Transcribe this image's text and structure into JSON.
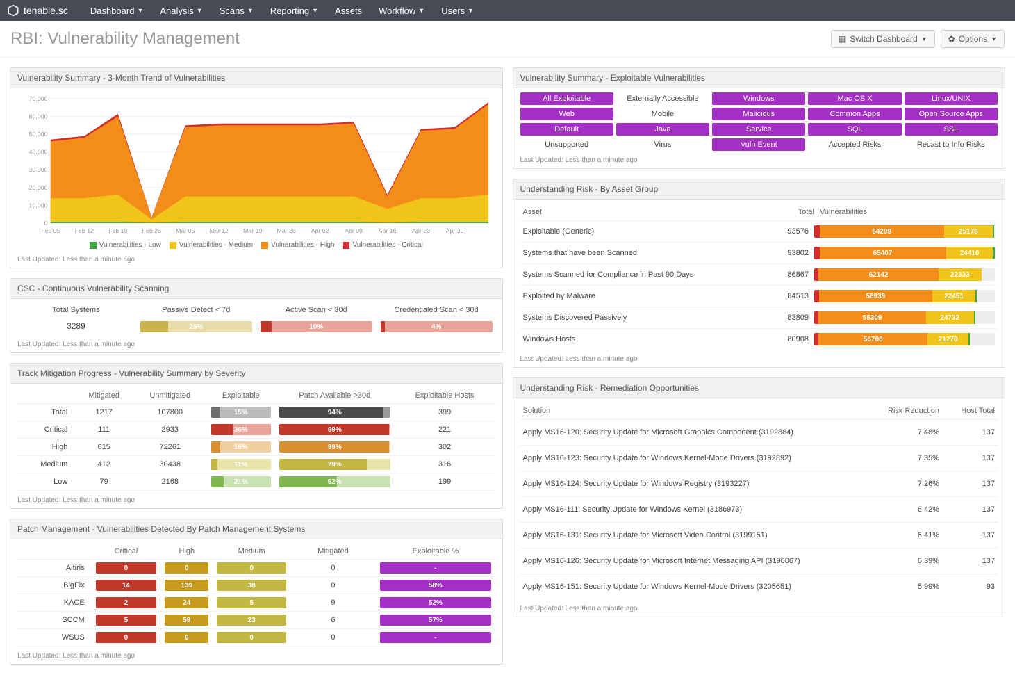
{
  "brand": "tenable.sc",
  "nav": [
    "Dashboard",
    "Analysis",
    "Scans",
    "Reporting",
    "Assets",
    "Workflow",
    "Users"
  ],
  "nav_nodrop": [
    "Assets"
  ],
  "page_title": "RBI: Vulnerability Management",
  "header_buttons": {
    "switch": "Switch Dashboard",
    "options": "Options"
  },
  "last_updated": "Last Updated: Less than a minute ago",
  "trend_panel": {
    "title": "Vulnerability Summary - 3-Month Trend of Vulnerabilities",
    "ymax": 70000,
    "yticks": [
      0,
      10000,
      20000,
      30000,
      40000,
      50000,
      60000,
      70000
    ],
    "xlabels": [
      "Feb 05",
      "Feb 12",
      "Feb 19",
      "Feb 26",
      "Mar 05",
      "Mar 12",
      "Mar 19",
      "Mar 26",
      "Apr 02",
      "Apr 09",
      "Apr 16",
      "Apr 23",
      "Apr 30"
    ],
    "legend": [
      {
        "label": "Vulnerabilities - Low",
        "color": "#3fa63f"
      },
      {
        "label": "Vulnerabilities - Medium",
        "color": "#f0c419"
      },
      {
        "label": "Vulnerabilities - High",
        "color": "#f28d1a"
      },
      {
        "label": "Vulnerabilities - Critical",
        "color": "#d32d2d"
      }
    ]
  },
  "chart_data": {
    "type": "area",
    "title": "Vulnerability Summary - 3-Month Trend of Vulnerabilities",
    "xlabel": "",
    "ylabel": "",
    "ylim": [
      0,
      70000
    ],
    "x": [
      "Feb 05",
      "Feb 12",
      "Feb 19",
      "Feb 26",
      "Mar 05",
      "Mar 12",
      "Mar 19",
      "Mar 26",
      "Apr 02",
      "Apr 09",
      "Apr 16",
      "Apr 23",
      "Apr 30",
      ""
    ],
    "series": [
      {
        "name": "Vulnerabilities - Low",
        "color": "#3fa63f",
        "values": [
          700,
          700,
          700,
          200,
          700,
          700,
          700,
          700,
          700,
          700,
          200,
          700,
          700,
          700
        ]
      },
      {
        "name": "Vulnerabilities - Medium",
        "color": "#f0c419",
        "values": [
          14000,
          14000,
          16000,
          2000,
          15000,
          15000,
          15000,
          15000,
          15000,
          15000,
          8000,
          14000,
          14000,
          16000
        ]
      },
      {
        "name": "Vulnerabilities - High",
        "color": "#f28d1a",
        "values": [
          46000,
          48000,
          60000,
          3000,
          54000,
          55000,
          55000,
          55000,
          55000,
          56000,
          15000,
          52000,
          53000,
          67000
        ]
      },
      {
        "name": "Vulnerabilities - Critical",
        "color": "#d32d2d",
        "values": [
          47000,
          49000,
          61500,
          3200,
          55000,
          56000,
          56000,
          56000,
          56000,
          57000,
          16000,
          53000,
          54000,
          68000
        ]
      }
    ]
  },
  "csc": {
    "title": "CSC - Continuous Vulnerability Scanning",
    "headers": [
      "Total Systems",
      "Passive Detect < 7d",
      "Active Scan < 30d",
      "Credentialed Scan < 30d"
    ],
    "total_systems": "3289",
    "bars": [
      {
        "pct": 25,
        "fill": "#cbb24b",
        "rest": "#e7dca7"
      },
      {
        "pct": 10,
        "fill": "#c0392b",
        "rest": "#e8a39b"
      },
      {
        "pct": 4,
        "fill": "#c0392b",
        "rest": "#e8a39b"
      }
    ]
  },
  "mitigation": {
    "title": "Track Mitigation Progress - Vulnerability Summary by Severity",
    "headers": [
      "",
      "Mitigated",
      "Unmitigated",
      "Exploitable",
      "Patch Available >30d",
      "Exploitable Hosts"
    ],
    "rows": [
      {
        "label": "Total",
        "mitigated": "1217",
        "unmitigated": "107800",
        "exp": {
          "pct": 15,
          "fill": "#6e6e6e",
          "rest": "#bcbcbc"
        },
        "patch": {
          "pct": 94,
          "fill": "#4a4a4a",
          "rest": "#9a9a9a"
        },
        "hosts": "399"
      },
      {
        "label": "Critical",
        "mitigated": "111",
        "unmitigated": "2933",
        "exp": {
          "pct": 36,
          "fill": "#c0392b",
          "rest": "#e8a39b"
        },
        "patch": {
          "pct": 99,
          "fill": "#c0392b",
          "rest": "#e8a39b"
        },
        "hosts": "221"
      },
      {
        "label": "High",
        "mitigated": "615",
        "unmitigated": "72261",
        "exp": {
          "pct": 16,
          "fill": "#d89033",
          "rest": "#f1cfa0"
        },
        "patch": {
          "pct": 99,
          "fill": "#d89033",
          "rest": "#f1cfa0"
        },
        "hosts": "302"
      },
      {
        "label": "Medium",
        "mitigated": "412",
        "unmitigated": "30438",
        "exp": {
          "pct": 11,
          "fill": "#c2b843",
          "rest": "#e8e3a9"
        },
        "patch": {
          "pct": 79,
          "fill": "#c2b843",
          "rest": "#e8e3a9"
        },
        "hosts": "316"
      },
      {
        "label": "Low",
        "mitigated": "79",
        "unmitigated": "2168",
        "exp": {
          "pct": 21,
          "fill": "#7fb84e",
          "rest": "#c9e2b1"
        },
        "patch": {
          "pct": 52,
          "fill": "#7fb84e",
          "rest": "#c9e2b1"
        },
        "hosts": "199"
      }
    ]
  },
  "patch": {
    "title": "Patch Management - Vulnerabilities Detected By Patch Management Systems",
    "headers": [
      "",
      "Critical",
      "High",
      "Medium",
      "Mitigated",
      "Exploitable %"
    ],
    "colors": {
      "crit": "#c0392b",
      "high": "#c69b1b",
      "med": "#c2b843",
      "exp": "#a42fc4"
    },
    "rows": [
      {
        "label": "Altiris",
        "crit": "0",
        "high": "0",
        "med": "0",
        "mit": "0",
        "exp": "-"
      },
      {
        "label": "BigFix",
        "crit": "14",
        "high": "139",
        "med": "38",
        "mit": "0",
        "exp": "58%"
      },
      {
        "label": "KACE",
        "crit": "2",
        "high": "24",
        "med": "5",
        "mit": "9",
        "exp": "52%"
      },
      {
        "label": "SCCM",
        "crit": "5",
        "high": "59",
        "med": "23",
        "mit": "6",
        "exp": "57%"
      },
      {
        "label": "WSUS",
        "crit": "0",
        "high": "0",
        "med": "0",
        "mit": "0",
        "exp": "-"
      }
    ]
  },
  "exploitable": {
    "title": "Vulnerability Summary - Exploitable Vulnerabilities",
    "cells": [
      {
        "t": "All Exploitable",
        "f": true
      },
      {
        "t": "Externally Accessible",
        "f": false
      },
      {
        "t": "Windows",
        "f": true
      },
      {
        "t": "Mac OS X",
        "f": true
      },
      {
        "t": "Linux/UNIX",
        "f": true
      },
      {
        "t": "Web",
        "f": true
      },
      {
        "t": "Mobile",
        "f": false
      },
      {
        "t": "Malicious",
        "f": true
      },
      {
        "t": "Common Apps",
        "f": true
      },
      {
        "t": "Open Source Apps",
        "f": true
      },
      {
        "t": "Default",
        "f": true
      },
      {
        "t": "Java",
        "f": true
      },
      {
        "t": "Service",
        "f": true
      },
      {
        "t": "SQL",
        "f": true
      },
      {
        "t": "SSL",
        "f": true
      },
      {
        "t": "Unsupported",
        "f": false
      },
      {
        "t": "Virus",
        "f": false
      },
      {
        "t": "Vuln Event",
        "f": true
      },
      {
        "t": "Accepted Risks",
        "f": false
      },
      {
        "t": "Recast to Info Risks",
        "f": false
      }
    ]
  },
  "asset_group": {
    "title": "Understanding Risk - By Asset Group",
    "headers": [
      "Asset",
      "Total",
      "Vulnerabilities"
    ],
    "max": 93802,
    "rows": [
      {
        "asset": "Exploitable (Generic)",
        "total": 93576,
        "crit": 2700,
        "high": 64299,
        "med": 25178,
        "low": 900
      },
      {
        "asset": "Systems that have been Scanned",
        "total": 93802,
        "crit": 2700,
        "high": 65407,
        "med": 24410,
        "low": 900
      },
      {
        "asset": "Systems Scanned for Compliance in Past 90 Days",
        "total": 86867,
        "crit": 2300,
        "high": 62142,
        "med": 22333,
        "low": 0
      },
      {
        "asset": "Exploited by Malware",
        "total": 84513,
        "crit": 2400,
        "high": 58939,
        "med": 22451,
        "low": 700
      },
      {
        "asset": "Systems Discovered Passively",
        "total": 83809,
        "crit": 2300,
        "high": 55309,
        "med": 24732,
        "low": 900
      },
      {
        "asset": "Windows Hosts",
        "total": 80908,
        "crit": 2200,
        "high": 56708,
        "med": 21270,
        "low": 700
      }
    ]
  },
  "remediation": {
    "title": "Understanding Risk - Remediation Opportunities",
    "headers": [
      "Solution",
      "Risk Reduction",
      "Host Total"
    ],
    "rows": [
      {
        "s": "Apply MS16-120: Security Update for Microsoft Graphics Component (3192884)",
        "r": "7.48%",
        "h": "137"
      },
      {
        "s": "Apply MS16-123: Security Update for Windows Kernel-Mode Drivers (3192892)",
        "r": "7.35%",
        "h": "137"
      },
      {
        "s": "Apply MS16-124: Security Update for Windows Registry (3193227)",
        "r": "7.26%",
        "h": "137"
      },
      {
        "s": "Apply MS16-111: Security Update for Windows Kernel (3186973)",
        "r": "6.42%",
        "h": "137"
      },
      {
        "s": "Apply MS16-131: Security Update for Microsoft Video Control (3199151)",
        "r": "6.41%",
        "h": "137"
      },
      {
        "s": "Apply MS16-126: Security Update for Microsoft Internet Messaging API (3196067)",
        "r": "6.39%",
        "h": "137"
      },
      {
        "s": "Apply MS16-151: Security Update for Windows Kernel-Mode Drivers (3205651)",
        "r": "5.99%",
        "h": "93"
      }
    ]
  }
}
